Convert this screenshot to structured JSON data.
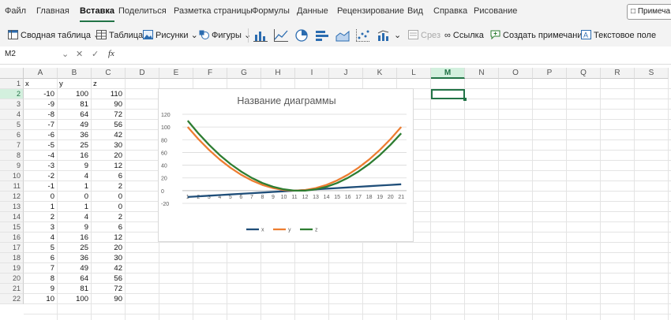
{
  "menu": {
    "tabs": [
      "Файл",
      "Главная",
      "Вставка",
      "Поделиться",
      "Разметка страницы",
      "Формулы",
      "Данные",
      "Рецензирование",
      "Вид",
      "Справка",
      "Рисование"
    ],
    "notes_button": "Примеча"
  },
  "ribbon": {
    "pivot_table": "Сводная таблица",
    "table": "Таблица",
    "pictures": "Рисунки",
    "shapes": "Фигуры",
    "slicer": "Срез",
    "link": "Ссылка",
    "comment": "Создать примечание",
    "textbox": "Текстовое поле"
  },
  "formula_bar": {
    "namebox": "M2",
    "fx": "fx",
    "value": ""
  },
  "sheet": {
    "columns": [
      "A",
      "B",
      "C",
      "D",
      "E",
      "F",
      "G",
      "H",
      "I",
      "J",
      "K",
      "L",
      "M",
      "N",
      "O",
      "P",
      "Q",
      "R",
      "S"
    ],
    "selected_column": "M",
    "selected_row": 2,
    "headers": [
      "x",
      "y",
      "z"
    ],
    "rows": [
      [
        -10,
        100,
        110
      ],
      [
        -9,
        81,
        90
      ],
      [
        -8,
        64,
        72
      ],
      [
        -7,
        49,
        56
      ],
      [
        -6,
        36,
        42
      ],
      [
        -5,
        25,
        30
      ],
      [
        -4,
        16,
        20
      ],
      [
        -3,
        9,
        12
      ],
      [
        -2,
        4,
        6
      ],
      [
        -1,
        1,
        2
      ],
      [
        0,
        0,
        0
      ],
      [
        1,
        1,
        0
      ],
      [
        2,
        4,
        2
      ],
      [
        3,
        9,
        6
      ],
      [
        4,
        16,
        12
      ],
      [
        5,
        25,
        20
      ],
      [
        6,
        36,
        30
      ],
      [
        7,
        49,
        42
      ],
      [
        8,
        64,
        56
      ],
      [
        9,
        81,
        72
      ],
      [
        10,
        100,
        90
      ]
    ]
  },
  "chart_data": {
    "type": "line",
    "title": "Название диаграммы",
    "categories": [
      "1",
      "2",
      "3",
      "4",
      "5",
      "6",
      "7",
      "8",
      "9",
      "10",
      "11",
      "12",
      "13",
      "14",
      "15",
      "16",
      "17",
      "18",
      "19",
      "20",
      "21"
    ],
    "ylim": [
      -20,
      120
    ],
    "yticks": [
      -20,
      0,
      20,
      40,
      60,
      80,
      100,
      120
    ],
    "legend_position": "bottom",
    "series": [
      {
        "name": "x",
        "color": "#1f4e79",
        "values": [
          -10,
          -9,
          -8,
          -7,
          -6,
          -5,
          -4,
          -3,
          -2,
          -1,
          0,
          1,
          2,
          3,
          4,
          5,
          6,
          7,
          8,
          9,
          10
        ]
      },
      {
        "name": "y",
        "color": "#ed7d31",
        "values": [
          100,
          81,
          64,
          49,
          36,
          25,
          16,
          9,
          4,
          1,
          0,
          1,
          4,
          9,
          16,
          25,
          36,
          49,
          64,
          81,
          100
        ]
      },
      {
        "name": "z",
        "color": "#2e7d32",
        "values": [
          110,
          90,
          72,
          56,
          42,
          30,
          20,
          12,
          6,
          2,
          0,
          0,
          2,
          6,
          12,
          20,
          30,
          42,
          56,
          72,
          90
        ]
      }
    ]
  }
}
